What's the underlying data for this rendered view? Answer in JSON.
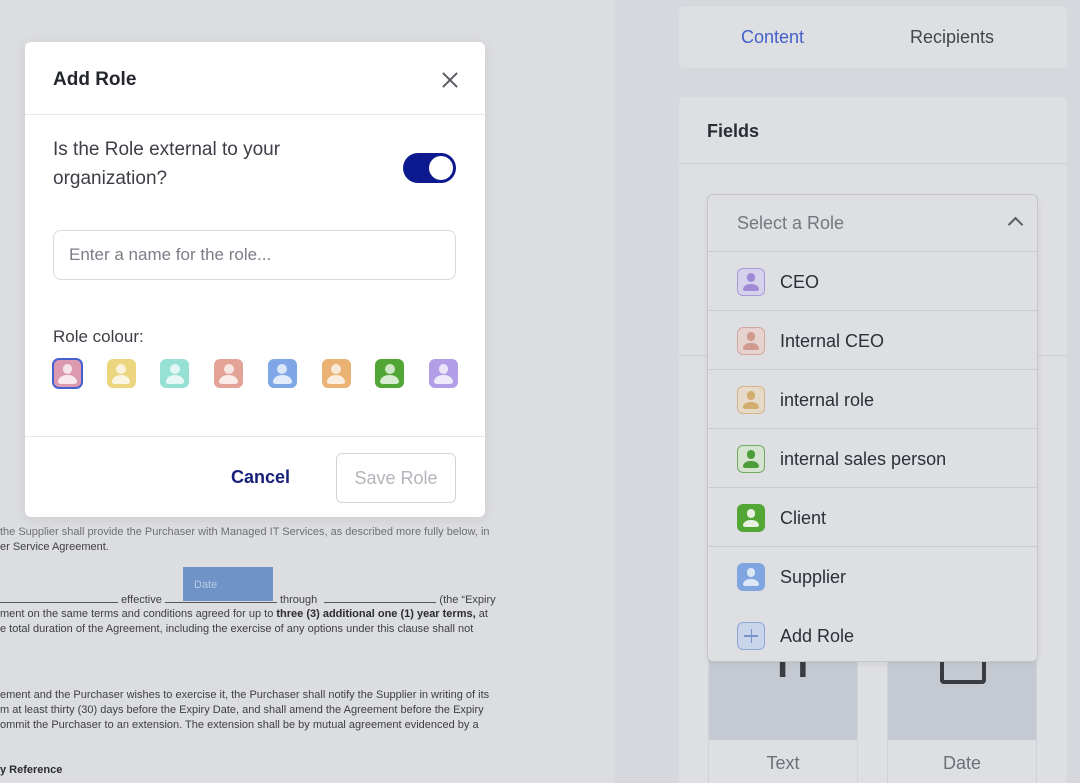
{
  "document": {
    "lines": [
      {
        "id": "l1",
        "html_parts": [
          "the Supplier shall provide the Purchaser with Managed IT Services, as described more fully below, in"
        ]
      },
      {
        "id": "l2",
        "text": "er Service Agreement."
      },
      {
        "id": "l3a",
        "text": "effective"
      },
      {
        "id": "l3b",
        "text": "through"
      },
      {
        "id": "l3c",
        "text": "(the “Expiry"
      },
      {
        "id": "l4a",
        "text": "ment on the same terms and conditions agreed for up to "
      },
      {
        "id": "l4b",
        "text": "three (3) additional one (1) year terms,"
      },
      {
        "id": "l4c",
        "text": " at"
      },
      {
        "id": "l5",
        "text": "e total duration of the Agreement, including the exercise of any options under this clause shall not"
      },
      {
        "id": "l6",
        "text": "ement and the Purchaser wishes to exercise it, the Purchaser shall notify the Supplier in writing of its"
      },
      {
        "id": "l7",
        "text": "m at least thirty (30) days before the Expiry Date, and shall amend the Agreement before the Expiry"
      },
      {
        "id": "l8",
        "text": "ommit the Purchaser to an extension. The extension shall be by mutual agreement evidenced by a"
      },
      {
        "id": "l9",
        "text": "y Reference"
      }
    ],
    "line1_prefix": "the Supplier shall provide the Purchaser with Managed IT Services, as described more fully below, in",
    "date_field_label": "Date"
  },
  "modal": {
    "title": "Add Role",
    "close_icon": "close-icon",
    "question": "Is the Role external to your organization?",
    "external_toggle": true,
    "name_input": {
      "value": "",
      "placeholder": "Enter a name for the role..."
    },
    "colour_label": "Role colour:",
    "colours": [
      {
        "name": "pink",
        "hex": "#dc9ab0",
        "selected": true
      },
      {
        "name": "yellow",
        "hex": "#ecd57f",
        "selected": false
      },
      {
        "name": "teal",
        "hex": "#96e0d4",
        "selected": false
      },
      {
        "name": "salmon",
        "hex": "#e3a497",
        "selected": false
      },
      {
        "name": "blue",
        "hex": "#7fa6e6",
        "selected": false
      },
      {
        "name": "orange",
        "hex": "#eab273",
        "selected": false
      },
      {
        "name": "green",
        "hex": "#52a636",
        "selected": false
      },
      {
        "name": "purple",
        "hex": "#b29ee6",
        "selected": false
      }
    ],
    "cancel_label": "Cancel",
    "save_label": "Save Role"
  },
  "panel": {
    "tabs": [
      {
        "label": "Content",
        "active": true
      },
      {
        "label": "Recipients",
        "active": false
      }
    ],
    "fields_title": "Fields",
    "role_select": {
      "placeholder": "Select a Role",
      "expanded": true,
      "options": [
        {
          "label": "CEO",
          "icon": "person-icon",
          "bg": "#d6d2ec",
          "fg": "#a08ad6",
          "border": "#a898d8"
        },
        {
          "label": "Internal CEO",
          "icon": "person-icon",
          "bg": "#e6d2cf",
          "fg": "#d19a8f",
          "border": "#d3a79f"
        },
        {
          "label": "internal role",
          "icon": "person-icon",
          "bg": "#e6dac8",
          "fg": "#d3ac6f",
          "border": "#d4b587"
        },
        {
          "label": "internal sales person",
          "icon": "person-icon",
          "bg": "#d6e3d0",
          "fg": "#4c9c38",
          "border": "#6fad5e"
        },
        {
          "label": "Client",
          "icon": "person-icon",
          "bg": "#52a636",
          "fg": "#e7f1e2",
          "border": "#52a636"
        },
        {
          "label": "Supplier",
          "icon": "person-icon",
          "bg": "#7fa6e0",
          "fg": "#dce7f6",
          "border": "#7fa6e0"
        }
      ],
      "add_label": "Add Role"
    },
    "field_tiles": [
      {
        "label": "Text",
        "icon": "text-field-icon"
      },
      {
        "label": "Date",
        "icon": "date-field-icon"
      }
    ]
  }
}
